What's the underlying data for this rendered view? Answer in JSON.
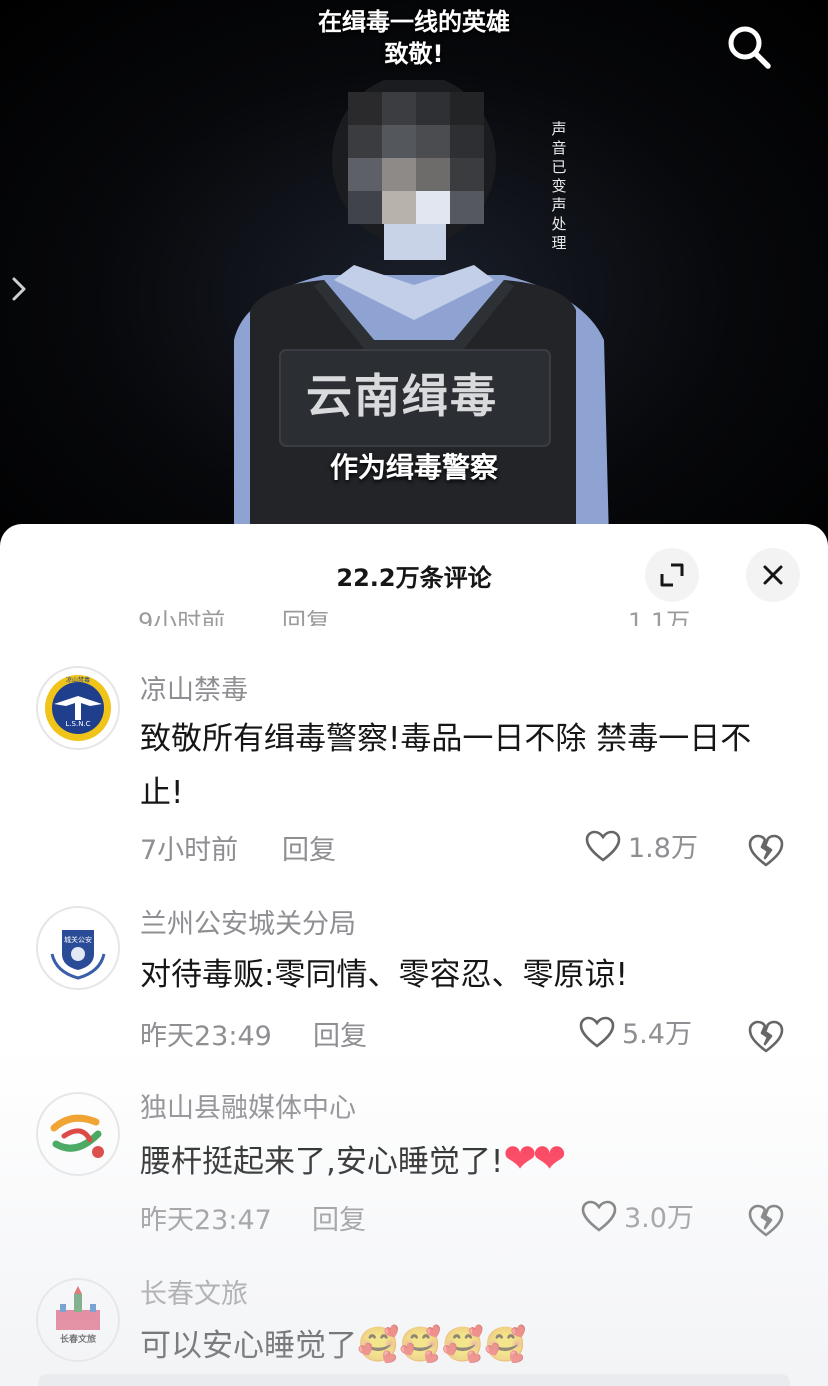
{
  "video": {
    "title_line1": "在缉毒一线的英雄",
    "title_line2": "致敬!",
    "vertical_note": "声音已变声处理",
    "patch_text": "云南缉毒",
    "subtitle": "作为缉毒警察",
    "search_icon": "search-icon",
    "side_arrow_icon": "chevron-right-icon"
  },
  "comments_panel": {
    "title": "22.2万条评论",
    "expand_icon": "expand-icon",
    "close_icon": "close-icon",
    "cut_time": "9小时前",
    "cut_reply": "回复",
    "cut_likes": "1.1万"
  },
  "comments": [
    {
      "user": "凉山禁毒",
      "text": "致敬所有缉毒警察!毒品一日不除 禁毒一日不止!",
      "time": "7小时前",
      "reply": "回复",
      "likes": "1.8万"
    },
    {
      "user": "兰州公安城关分局",
      "text": "对待毒贩:零同情、零容忍、零原谅!",
      "time": "昨天23:49",
      "reply": "回复",
      "likes": "5.4万"
    },
    {
      "user": "独山县融媒体中心",
      "text": "腰杆挺起来了,安心睡觉了!",
      "emoji": "❤❤",
      "time": "昨天23:47",
      "reply": "回复",
      "likes": "3.0万"
    },
    {
      "user": "长春文旅",
      "text": "可以安心睡觉了",
      "emoji": "🥰🥰🥰🥰"
    }
  ],
  "avatars": {
    "a1_text": "凉山禁毒",
    "a1_arc": "LIANGSHAN NARCOTICS CONTROL",
    "a1_badge": "L.S.N.C",
    "a2_text": "城关公安",
    "a4_text": "长春文旅"
  },
  "colors": {
    "accent_red": "#ff2b4a",
    "text_dark": "#161616",
    "text_gray": "#8e8e93"
  }
}
